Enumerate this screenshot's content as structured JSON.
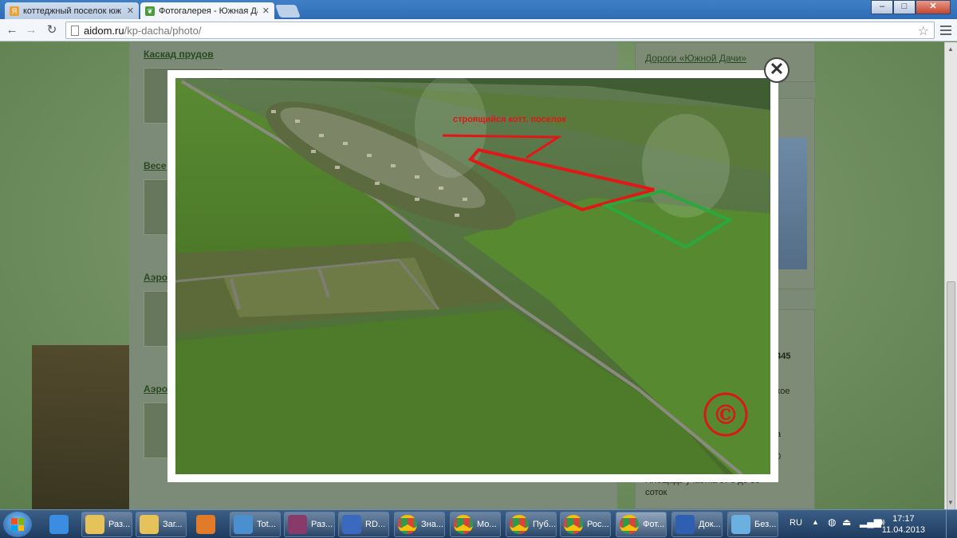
{
  "browser": {
    "tabs": [
      {
        "label": "коттеджный поселок юж",
        "favicon": "yandex-icon",
        "color": "#e8a23a",
        "active": false
      },
      {
        "label": "Фотогалерея - Южная Да",
        "favicon": "leaf-icon",
        "color": "#4a9b3a",
        "active": true
      }
    ],
    "url_host": "aidom.ru",
    "url_path": "/kp-dacha/photo/",
    "window_buttons": {
      "minimize": "–",
      "maximize": "□",
      "close": "✕"
    }
  },
  "page": {
    "links": [
      "Каскад прудов",
      "Весе",
      "Аэро",
      "Аэро"
    ],
    "sidebar_link": "Дороги «Южной Дачи»",
    "sidebar_texts": [
      "6445",
      "цкое",
      "а",
      "0",
      "Площадь участка от 6 до 30",
      "соток"
    ]
  },
  "lightbox": {
    "close_label": "✕",
    "photo_annotation": "строящийся котт. поселок",
    "watermark": "©"
  },
  "taskbar": {
    "items": [
      {
        "label": "",
        "icon": "ie-icon",
        "color": "#3a8de0",
        "pinned": true
      },
      {
        "label": "Раз...",
        "icon": "folder-icon",
        "color": "#e6c35a"
      },
      {
        "label": "Заг...",
        "icon": "folder-icon",
        "color": "#e6c35a"
      },
      {
        "label": "",
        "icon": "media-player-icon",
        "color": "#e07b2a",
        "pinned": true
      },
      {
        "label": "Tot...",
        "icon": "total-commander-icon",
        "color": "#4a8fd0"
      },
      {
        "label": "Раз...",
        "icon": "winrar-icon",
        "color": "#8a3a6a"
      },
      {
        "label": "RD...",
        "icon": "remote-desktop-icon",
        "color": "#3a6ac0"
      },
      {
        "label": "Зна...",
        "icon": "chrome-icon",
        "color": "#d9443a"
      },
      {
        "label": "Мо...",
        "icon": "chrome-icon",
        "color": "#d9443a"
      },
      {
        "label": "Пуб...",
        "icon": "chrome-icon",
        "color": "#d9443a"
      },
      {
        "label": "Рос...",
        "icon": "chrome-icon",
        "color": "#d9443a"
      },
      {
        "label": "Фот...",
        "icon": "chrome-icon",
        "color": "#d9443a",
        "active": true
      },
      {
        "label": "Док...",
        "icon": "word-icon",
        "color": "#2f5fb0"
      },
      {
        "label": "Без...",
        "icon": "paint-icon",
        "color": "#6ab0e0"
      }
    ],
    "language": "RU",
    "time": "17:17",
    "date": "11.04.2013"
  }
}
